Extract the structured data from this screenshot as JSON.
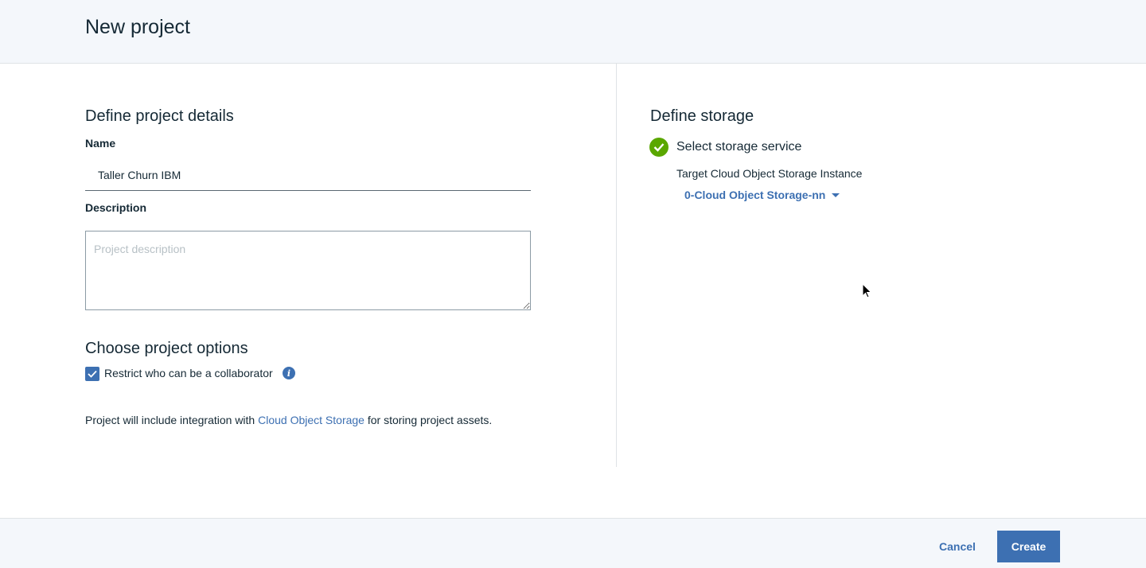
{
  "header": {
    "title": "New project"
  },
  "details": {
    "title": "Define project details",
    "name_label": "Name",
    "name_value": "Taller Churn IBM",
    "description_label": "Description",
    "description_placeholder": "Project description"
  },
  "options": {
    "title": "Choose project options",
    "restrict_label": "Restrict who can be a collaborator",
    "restrict_checked": true,
    "info_icon": "info-icon",
    "integration_prefix": "Project will include integration with ",
    "integration_link": "Cloud Object Storage",
    "integration_suffix": " for storing project assets."
  },
  "storage": {
    "title": "Define storage",
    "step_label": "Select storage service",
    "target_label": "Target Cloud Object Storage Instance",
    "selected_instance": "0-Cloud Object Storage-nn"
  },
  "footer": {
    "cancel_label": "Cancel",
    "create_label": "Create"
  },
  "colors": {
    "accent": "#3d70b2",
    "success": "#5aa700",
    "text": "#152935",
    "panel_bg": "#f4f7fb"
  }
}
